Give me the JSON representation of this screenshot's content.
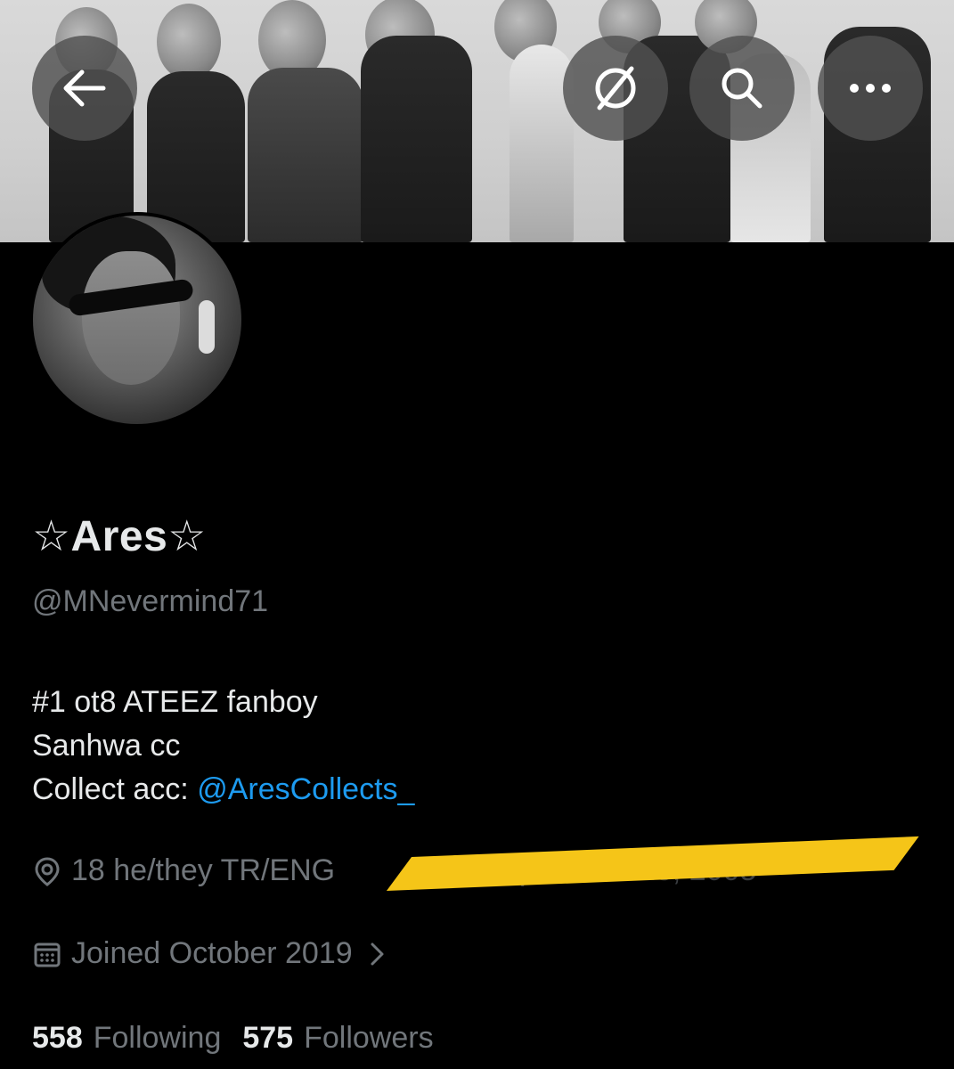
{
  "profile": {
    "display_name": "☆Ares☆",
    "handle": "@MNevermind71"
  },
  "bio": {
    "line1": "#1 ot8 ATEEZ fanboy",
    "line2": "Sanhwa cc",
    "line3_prefix": "Collect acc: ",
    "line3_mention": "@AresCollects_"
  },
  "meta": {
    "location": "18 he/they TR/ENG",
    "birthday_redacted_text": "Born September 23, 2005",
    "joined": "Joined October 2019"
  },
  "stats": {
    "following_count": "558",
    "following_label": "Following",
    "followers_count": "575",
    "followers_label": "Followers"
  },
  "header_buttons": {
    "back_icon": "back-arrow-icon",
    "grok_icon": "grok-icon",
    "search_icon": "search-icon",
    "more_icon": "more-icon"
  },
  "colors": {
    "background": "#000000",
    "primary_text": "#e7e9ea",
    "secondary_text": "#71767b",
    "link": "#1d9bf0",
    "redaction": "#f5c518"
  }
}
